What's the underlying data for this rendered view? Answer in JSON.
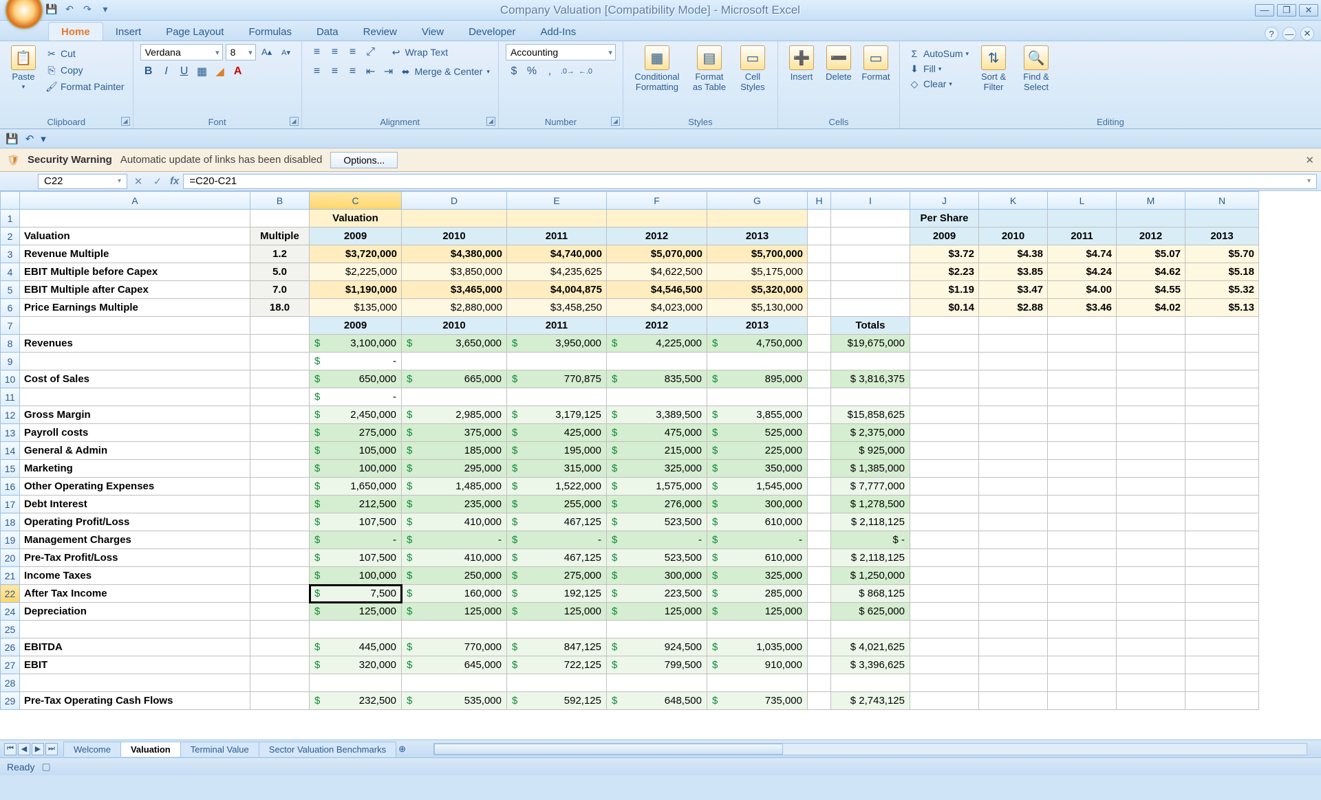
{
  "window_title": "Company Valuation  [Compatibility Mode] - Microsoft Excel",
  "tabs": [
    "Home",
    "Insert",
    "Page Layout",
    "Formulas",
    "Data",
    "Review",
    "View",
    "Developer",
    "Add-Ins"
  ],
  "active_tab": "Home",
  "ribbon": {
    "clipboard": {
      "label": "Clipboard",
      "paste": "Paste",
      "cut": "Cut",
      "copy": "Copy",
      "fp": "Format Painter"
    },
    "font": {
      "label": "Font",
      "name": "Verdana",
      "size": "8"
    },
    "alignment": {
      "label": "Alignment",
      "wrap": "Wrap Text",
      "merge": "Merge & Center"
    },
    "number": {
      "label": "Number",
      "format": "Accounting"
    },
    "styles": {
      "label": "Styles",
      "cf": "Conditional Formatting",
      "fat": "Format as Table",
      "cs": "Cell Styles"
    },
    "cells": {
      "label": "Cells",
      "ins": "Insert",
      "del": "Delete",
      "fmt": "Format"
    },
    "editing": {
      "label": "Editing",
      "autosum": "AutoSum",
      "fill": "Fill",
      "clear": "Clear",
      "sort": "Sort & Filter",
      "find": "Find & Select"
    }
  },
  "security": {
    "title": "Security Warning",
    "msg": "Automatic update of links has been disabled",
    "btn": "Options..."
  },
  "namebox": "C22",
  "formula": "=C20-C21",
  "cols": [
    "A",
    "B",
    "C",
    "D",
    "E",
    "F",
    "G",
    "H",
    "I",
    "J",
    "K",
    "L",
    "M",
    "N"
  ],
  "header1": {
    "C": "Valuation",
    "J": "Per Share"
  },
  "header2": {
    "A": "Valuation",
    "B": "Multiple",
    "years": [
      "2009",
      "2010",
      "2011",
      "2012",
      "2013"
    ]
  },
  "val_rows": [
    {
      "lbl": "Revenue Multiple",
      "mult": "1.2",
      "v": [
        "$3,720,000",
        "$4,380,000",
        "$4,740,000",
        "$5,070,000",
        "$5,700,000"
      ],
      "ps": [
        "$3.72",
        "$4.38",
        "$4.74",
        "$5.07",
        "$5.70"
      ]
    },
    {
      "lbl": "EBIT Multiple before Capex",
      "mult": "5.0",
      "v": [
        "$2,225,000",
        "$3,850,000",
        "$4,235,625",
        "$4,622,500",
        "$5,175,000"
      ],
      "ps": [
        "$2.23",
        "$3.85",
        "$4.24",
        "$4.62",
        "$5.18"
      ]
    },
    {
      "lbl": "EBIT Multiple after Capex",
      "mult": "7.0",
      "v": [
        "$1,190,000",
        "$3,465,000",
        "$4,004,875",
        "$4,546,500",
        "$5,320,000"
      ],
      "ps": [
        "$1.19",
        "$3.47",
        "$4.00",
        "$4.55",
        "$5.32"
      ]
    },
    {
      "lbl": "Price Earnings Multiple",
      "mult": "18.0",
      "v": [
        "$135,000",
        "$2,880,000",
        "$3,458,250",
        "$4,023,000",
        "$5,130,000"
      ],
      "ps": [
        "$0.14",
        "$2.88",
        "$3.46",
        "$4.02",
        "$5.13"
      ]
    }
  ],
  "totals_label": "Totals",
  "fin_rows": [
    {
      "r": 8,
      "lbl": "Revenues",
      "v": [
        "3,100,000",
        "3,650,000",
        "3,950,000",
        "4,225,000",
        "4,750,000"
      ],
      "tot": "$19,675,000",
      "cls": "green-row"
    },
    {
      "r": 9,
      "lbl": "",
      "v": [
        "-",
        "",
        "",
        "",
        ""
      ],
      "tot": "",
      "cls": ""
    },
    {
      "r": 10,
      "lbl": "Cost of Sales",
      "v": [
        "650,000",
        "665,000",
        "770,875",
        "835,500",
        "895,000"
      ],
      "tot": "$ 3,816,375",
      "cls": "green-row"
    },
    {
      "r": 11,
      "lbl": "",
      "v": [
        "-",
        "",
        "",
        "",
        ""
      ],
      "tot": "",
      "cls": ""
    },
    {
      "r": 12,
      "lbl": "Gross Margin",
      "v": [
        "2,450,000",
        "2,985,000",
        "3,179,125",
        "3,389,500",
        "3,855,000"
      ],
      "tot": "$15,858,625",
      "cls": "green-lite"
    },
    {
      "r": 13,
      "lbl": "Payroll costs",
      "v": [
        "275,000",
        "375,000",
        "425,000",
        "475,000",
        "525,000"
      ],
      "tot": "$ 2,375,000",
      "cls": "green-row"
    },
    {
      "r": 14,
      "lbl": "General & Admin",
      "v": [
        "105,000",
        "185,000",
        "195,000",
        "215,000",
        "225,000"
      ],
      "tot": "$   925,000",
      "cls": "green-row"
    },
    {
      "r": 15,
      "lbl": "Marketing",
      "v": [
        "100,000",
        "295,000",
        "315,000",
        "325,000",
        "350,000"
      ],
      "tot": "$ 1,385,000",
      "cls": "green-row"
    },
    {
      "r": 16,
      "lbl": "Other Operating Expenses",
      "v": [
        "1,650,000",
        "1,485,000",
        "1,522,000",
        "1,575,000",
        "1,545,000"
      ],
      "tot": "$ 7,777,000",
      "cls": "green-lite"
    },
    {
      "r": 17,
      "lbl": "Debt Interest",
      "v": [
        "212,500",
        "235,000",
        "255,000",
        "276,000",
        "300,000"
      ],
      "tot": "$ 1,278,500",
      "cls": "green-row"
    },
    {
      "r": 18,
      "lbl": "Operating Profit/Loss",
      "v": [
        "107,500",
        "410,000",
        "467,125",
        "523,500",
        "610,000"
      ],
      "tot": "$ 2,118,125",
      "cls": "green-lite"
    },
    {
      "r": 19,
      "lbl": "Management Charges",
      "v": [
        "-",
        "-",
        "-",
        "-",
        "-"
      ],
      "tot": "$            -",
      "cls": "green-row"
    },
    {
      "r": 20,
      "lbl": "Pre-Tax Profit/Loss",
      "v": [
        "107,500",
        "410,000",
        "467,125",
        "523,500",
        "610,000"
      ],
      "tot": "$ 2,118,125",
      "cls": "green-lite"
    },
    {
      "r": 21,
      "lbl": "Income Taxes",
      "v": [
        "100,000",
        "250,000",
        "275,000",
        "300,000",
        "325,000"
      ],
      "tot": "$ 1,250,000",
      "cls": "green-row"
    },
    {
      "r": 22,
      "lbl": "After Tax Income",
      "v": [
        "7,500",
        "160,000",
        "192,125",
        "223,500",
        "285,000"
      ],
      "tot": "$   868,125",
      "cls": "green-lite",
      "active": true
    },
    {
      "r": 24,
      "lbl": "Depreciation",
      "v": [
        "125,000",
        "125,000",
        "125,000",
        "125,000",
        "125,000"
      ],
      "tot": "$   625,000",
      "cls": "green-row"
    },
    {
      "r": 25,
      "lbl": "",
      "v": [
        "",
        "",
        "",
        "",
        ""
      ],
      "tot": "",
      "cls": ""
    },
    {
      "r": 26,
      "lbl": "EBITDA",
      "v": [
        "445,000",
        "770,000",
        "847,125",
        "924,500",
        "1,035,000"
      ],
      "tot": "$ 4,021,625",
      "cls": "green-lite"
    },
    {
      "r": 27,
      "lbl": "EBIT",
      "v": [
        "320,000",
        "645,000",
        "722,125",
        "799,500",
        "910,000"
      ],
      "tot": "$ 3,396,625",
      "cls": "green-lite"
    },
    {
      "r": 28,
      "lbl": "",
      "v": [
        "",
        "",
        "",
        "",
        ""
      ],
      "tot": "",
      "cls": ""
    },
    {
      "r": 29,
      "lbl": "Pre-Tax Operating Cash Flows",
      "v": [
        "232,500",
        "535,000",
        "592,125",
        "648,500",
        "735,000"
      ],
      "tot": "$ 2,743,125",
      "cls": "green-lite"
    }
  ],
  "sheet_tabs": [
    "Welcome",
    "Valuation",
    "Terminal Value",
    "Sector Valuation Benchmarks"
  ],
  "active_sheet": "Valuation",
  "status": "Ready"
}
